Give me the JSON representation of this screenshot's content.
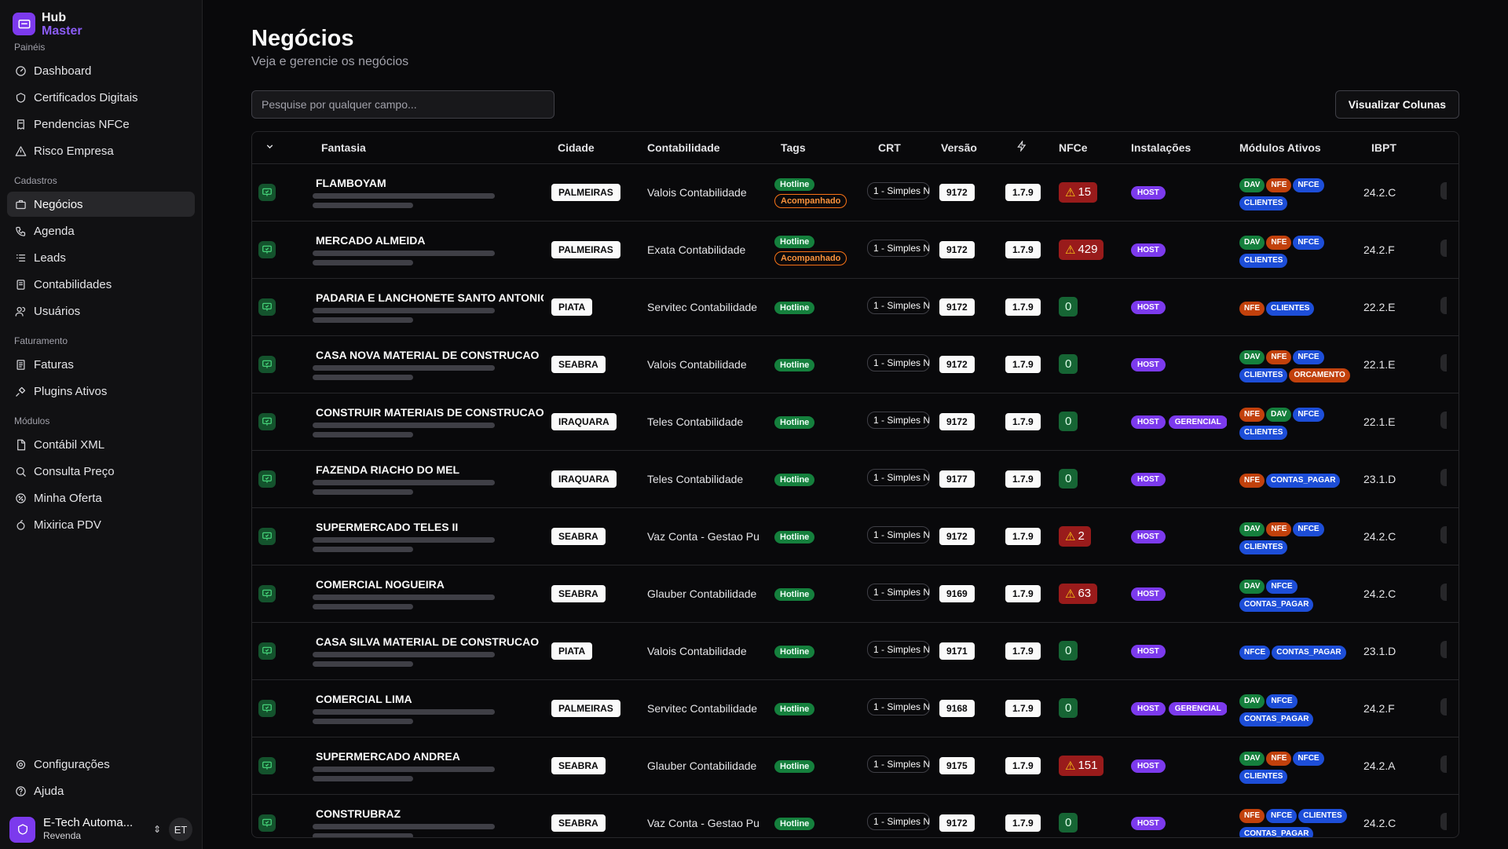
{
  "brand": {
    "line1": "Hub",
    "line2": "Master"
  },
  "sidebar": {
    "groups": [
      {
        "label": "Painéis",
        "items": [
          {
            "label": "Dashboard",
            "icon": "gauge-icon"
          },
          {
            "label": "Certificados Digitais",
            "icon": "shield-icon"
          },
          {
            "label": "Pendencias NFCe",
            "icon": "receipt-icon"
          },
          {
            "label": "Risco Empresa",
            "icon": "alert-icon"
          }
        ]
      },
      {
        "label": "Cadastros",
        "items": [
          {
            "label": "Negócios",
            "icon": "briefcase-icon",
            "active": true
          },
          {
            "label": "Agenda",
            "icon": "phone-icon"
          },
          {
            "label": "Leads",
            "icon": "list-icon"
          },
          {
            "label": "Contabilidades",
            "icon": "book-icon"
          },
          {
            "label": "Usuários",
            "icon": "users-icon"
          }
        ]
      },
      {
        "label": "Faturamento",
        "items": [
          {
            "label": "Faturas",
            "icon": "invoice-icon"
          },
          {
            "label": "Plugins Ativos",
            "icon": "plug-icon"
          }
        ]
      },
      {
        "label": "Módulos",
        "items": [
          {
            "label": "Contábil XML",
            "icon": "file-icon"
          },
          {
            "label": "Consulta Preço",
            "icon": "search-icon"
          },
          {
            "label": "Minha Oferta",
            "icon": "badge-icon"
          },
          {
            "label": "Mixirica PDV",
            "icon": "fruit-icon"
          }
        ]
      }
    ],
    "bottom": [
      {
        "label": "Configurações",
        "icon": "gear-icon"
      },
      {
        "label": "Ajuda",
        "icon": "help-icon"
      }
    ],
    "user": {
      "name": "E-Tech Automa...",
      "role": "Revenda",
      "initials": "ET"
    }
  },
  "page": {
    "title": "Negócios",
    "subtitle": "Veja e gerencie os negócios"
  },
  "toolbar": {
    "search_placeholder": "Pesquise por qualquer campo...",
    "columns_button": "Visualizar Colunas"
  },
  "table": {
    "headers": {
      "fantasia": "Fantasia",
      "cidade": "Cidade",
      "contabilidade": "Contabilidade",
      "tags": "Tags",
      "crt": "CRT",
      "versao": "Versão",
      "nfce": "NFCe",
      "instalacoes": "Instalações",
      "modulos": "Módulos Ativos",
      "ibpt": "IBPT"
    },
    "rows": [
      {
        "fantasia": "FLAMBOYAM",
        "cidade": "PALMEIRAS",
        "contabilidade": "Valois Contabilidade",
        "tags": [
          "Hotline",
          "Acompanhado"
        ],
        "crt": "1 - Simples N",
        "versao": "9172",
        "plugin": "1.7.9",
        "nfce": "15",
        "nfce_alert": true,
        "instalacoes": [
          "HOST"
        ],
        "modulos": [
          "DAV",
          "NFE",
          "NFCE",
          "CLIENTES"
        ],
        "ibpt": "24.2.C"
      },
      {
        "fantasia": "MERCADO ALMEIDA",
        "cidade": "PALMEIRAS",
        "contabilidade": "Exata Contabilidade",
        "tags": [
          "Hotline",
          "Acompanhado"
        ],
        "crt": "1 - Simples N",
        "versao": "9172",
        "plugin": "1.7.9",
        "nfce": "429",
        "nfce_alert": true,
        "instalacoes": [
          "HOST"
        ],
        "modulos": [
          "DAV",
          "NFE",
          "NFCE",
          "CLIENTES"
        ],
        "ibpt": "24.2.F"
      },
      {
        "fantasia": "PADARIA E LANCHONETE SANTO ANTONIO",
        "cidade": "PIATA",
        "contabilidade": "Servitec Contabilidade",
        "tags": [
          "Hotline"
        ],
        "crt": "1 - Simples N",
        "versao": "9172",
        "plugin": "1.7.9",
        "nfce": "0",
        "nfce_alert": false,
        "instalacoes": [
          "HOST"
        ],
        "modulos": [
          "NFE",
          "CLIENTES"
        ],
        "ibpt": "22.2.E"
      },
      {
        "fantasia": "CASA NOVA MATERIAL DE CONSTRUCAO",
        "cidade": "SEABRA",
        "contabilidade": "Valois Contabilidade",
        "tags": [
          "Hotline"
        ],
        "crt": "1 - Simples N",
        "versao": "9172",
        "plugin": "1.7.9",
        "nfce": "0",
        "nfce_alert": false,
        "instalacoes": [
          "HOST"
        ],
        "modulos": [
          "DAV",
          "NFE",
          "NFCE",
          "CLIENTES",
          "ORCAMENTO"
        ],
        "ibpt": "22.1.E"
      },
      {
        "fantasia": "CONSTRUIR MATERIAIS DE CONSTRUCAO",
        "cidade": "IRAQUARA",
        "contabilidade": "Teles Contabilidade",
        "tags": [
          "Hotline"
        ],
        "crt": "1 - Simples N",
        "versao": "9172",
        "plugin": "1.7.9",
        "nfce": "0",
        "nfce_alert": false,
        "instalacoes": [
          "HOST",
          "GERENCIAL"
        ],
        "modulos": [
          "NFE",
          "DAV",
          "NFCE",
          "CLIENTES"
        ],
        "ibpt": "22.1.E"
      },
      {
        "fantasia": "FAZENDA RIACHO DO MEL",
        "cidade": "IRAQUARA",
        "contabilidade": "Teles Contabilidade",
        "tags": [
          "Hotline"
        ],
        "crt": "1 - Simples N",
        "versao": "9177",
        "plugin": "1.7.9",
        "nfce": "0",
        "nfce_alert": false,
        "instalacoes": [
          "HOST"
        ],
        "modulos": [
          "NFE",
          "CONTAS_PAGAR"
        ],
        "ibpt": "23.1.D"
      },
      {
        "fantasia": "SUPERMERCADO TELES II",
        "cidade": "SEABRA",
        "contabilidade": "Vaz Conta - Gestao Pu",
        "tags": [
          "Hotline"
        ],
        "crt": "1 - Simples N",
        "versao": "9172",
        "plugin": "1.7.9",
        "nfce": "2",
        "nfce_alert": true,
        "instalacoes": [
          "HOST"
        ],
        "modulos": [
          "DAV",
          "NFE",
          "NFCE",
          "CLIENTES"
        ],
        "ibpt": "24.2.C"
      },
      {
        "fantasia": "COMERCIAL NOGUEIRA",
        "cidade": "SEABRA",
        "contabilidade": "Glauber Contabilidade",
        "tags": [
          "Hotline"
        ],
        "crt": "1 - Simples N",
        "versao": "9169",
        "plugin": "1.7.9",
        "nfce": "63",
        "nfce_alert": true,
        "instalacoes": [
          "HOST"
        ],
        "modulos": [
          "DAV",
          "NFCE",
          "CONTAS_PAGAR"
        ],
        "ibpt": "24.2.C"
      },
      {
        "fantasia": "CASA SILVA MATERIAL DE CONSTRUCAO",
        "cidade": "PIATA",
        "contabilidade": "Valois Contabilidade",
        "tags": [
          "Hotline"
        ],
        "crt": "1 - Simples N",
        "versao": "9171",
        "plugin": "1.7.9",
        "nfce": "0",
        "nfce_alert": false,
        "instalacoes": [
          "HOST"
        ],
        "modulos": [
          "NFCE",
          "CONTAS_PAGAR"
        ],
        "ibpt": "23.1.D"
      },
      {
        "fantasia": "COMERCIAL LIMA",
        "cidade": "PALMEIRAS",
        "contabilidade": "Servitec Contabilidade",
        "tags": [
          "Hotline"
        ],
        "crt": "1 - Simples N",
        "versao": "9168",
        "plugin": "1.7.9",
        "nfce": "0",
        "nfce_alert": false,
        "instalacoes": [
          "HOST",
          "GERENCIAL"
        ],
        "modulos": [
          "DAV",
          "NFCE",
          "CONTAS_PAGAR"
        ],
        "ibpt": "24.2.F"
      },
      {
        "fantasia": "SUPERMERCADO ANDREA",
        "cidade": "SEABRA",
        "contabilidade": "Glauber Contabilidade",
        "tags": [
          "Hotline"
        ],
        "crt": "1 - Simples N",
        "versao": "9175",
        "plugin": "1.7.9",
        "nfce": "151",
        "nfce_alert": true,
        "instalacoes": [
          "HOST"
        ],
        "modulos": [
          "DAV",
          "NFE",
          "NFCE",
          "CLIENTES"
        ],
        "ibpt": "24.2.A"
      },
      {
        "fantasia": "CONSTRUBRAZ",
        "cidade": "SEABRA",
        "contabilidade": "Vaz Conta - Gestao Pu",
        "tags": [
          "Hotline"
        ],
        "crt": "1 - Simples N",
        "versao": "9172",
        "plugin": "1.7.9",
        "nfce": "0",
        "nfce_alert": false,
        "instalacoes": [
          "HOST"
        ],
        "modulos": [
          "NFE",
          "NFCE",
          "CLIENTES",
          "CONTAS_PAGAR"
        ],
        "ibpt": "24.2.C"
      }
    ]
  }
}
